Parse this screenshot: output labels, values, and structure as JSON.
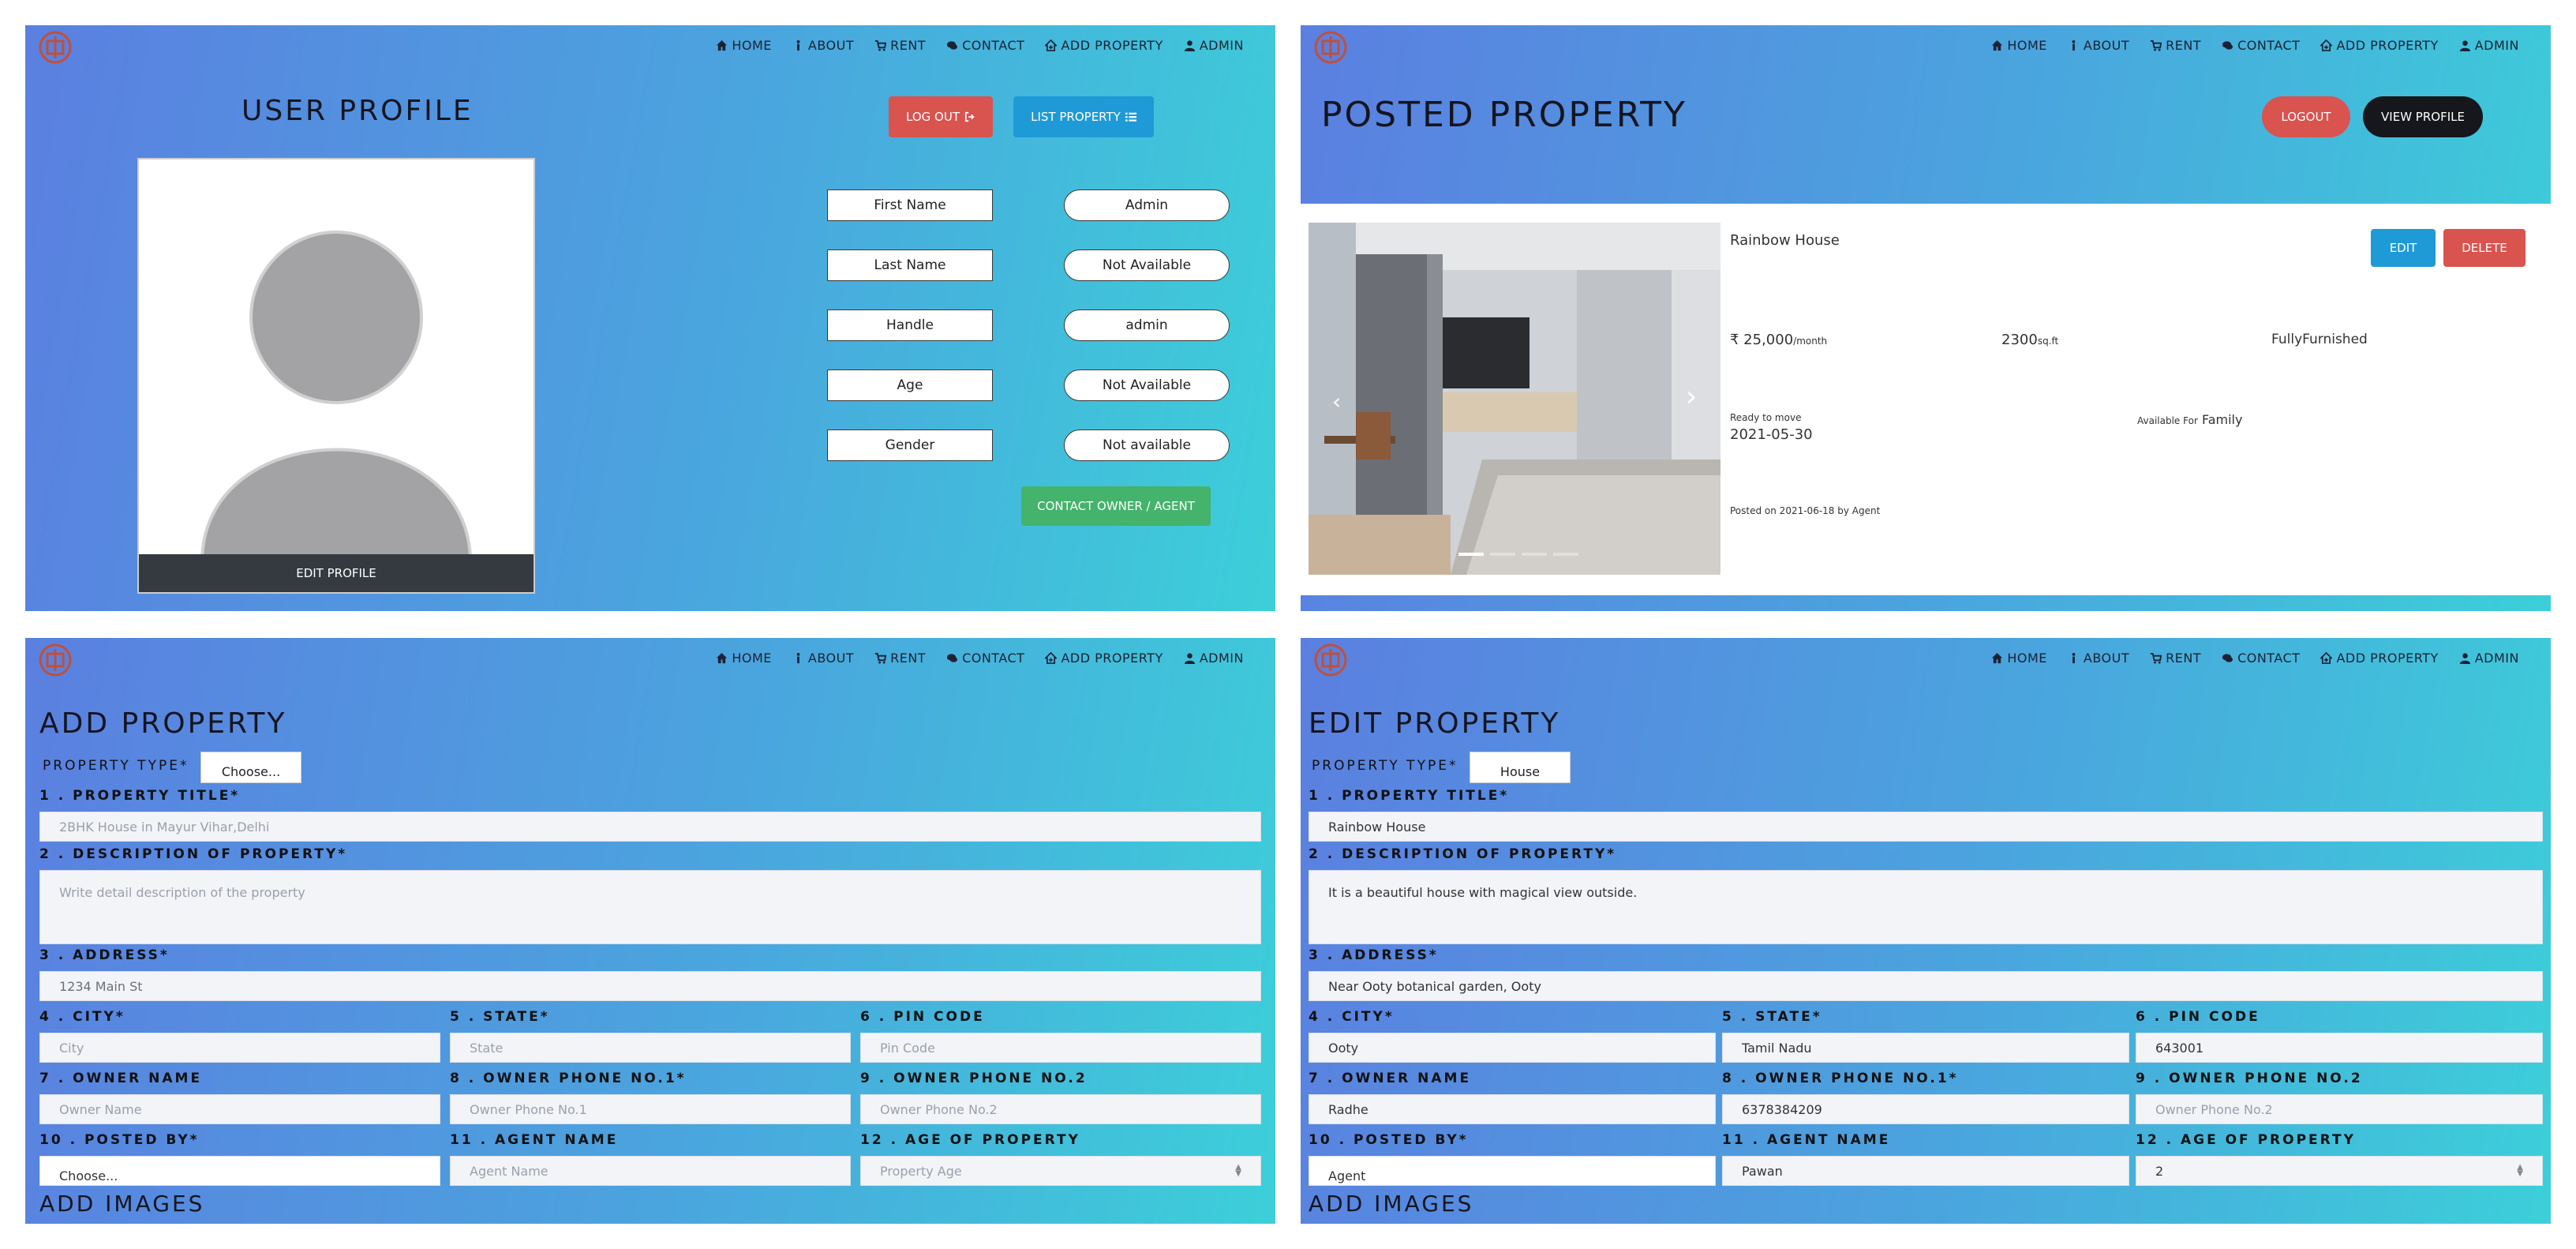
{
  "nav": {
    "home": "HOME",
    "about": "ABOUT",
    "rent": "RENT",
    "contact": "CONTACT",
    "add_property": "ADD PROPERTY",
    "admin": "ADMIN"
  },
  "user_profile": {
    "title": "USER PROFILE",
    "logout_label": "LOG OUT",
    "list_property_label": "LIST PROPERTY",
    "edit_profile_label": "EDIT PROFILE",
    "contact_label": "CONTACT OWNER / AGENT",
    "fields": [
      {
        "label": "First Name",
        "value": "Admin"
      },
      {
        "label": "Last Name",
        "value": "Not Available"
      },
      {
        "label": "Handle",
        "value": "admin"
      },
      {
        "label": "Age",
        "value": "Not Available"
      },
      {
        "label": "Gender",
        "value": "Not available"
      }
    ]
  },
  "posted_property": {
    "title": "POSTED PROPERTY",
    "logout_label": "LOGOUT",
    "view_profile_label": "VIEW PROFILE",
    "card": {
      "name": "Rainbow House",
      "edit_label": "EDIT",
      "delete_label": "DELETE",
      "price": "₹ 25,000",
      "price_unit": "/month",
      "area": "2300",
      "area_unit": "sq.ft",
      "furnishing": "FullyFurnished",
      "ready_label": "Ready to move",
      "ready_date": "2021-05-30",
      "available_label": "Available For",
      "available_value": "Family",
      "posted": "Posted on 2021-06-18 by Agent"
    }
  },
  "add_property": {
    "title": "ADD PROPERTY",
    "type_label": "PROPERTY TYPE*",
    "type_value": "Choose...",
    "l_title": "1 . PROPERTY TITLE*",
    "title_value": "2BHK House in Mayur Vihar,Delhi",
    "l_desc": "2 . DESCRIPTION OF PROPERTY*",
    "desc_value": "Write detail description of the property",
    "l_address": "3 . ADDRESS*",
    "address_value": "1234 Main St",
    "l_city": "4 . CITY*",
    "city_value": "City",
    "l_state": "5 . STATE*",
    "state_value": "State",
    "l_pin": "6 . PIN CODE",
    "pin_value": "Pin Code",
    "l_owner": "7 . OWNER NAME",
    "owner_value": "Owner Name",
    "l_phone1": "8 . OWNER PHONE NO.1*",
    "phone1_value": "Owner Phone No.1",
    "l_phone2": "9 . OWNER PHONE NO.2",
    "phone2_value": "Owner Phone No.2",
    "l_posted": "10 . POSTED BY*",
    "posted_value": "Choose...",
    "l_agent": "11 . AGENT NAME",
    "agent_value": "Agent Name",
    "l_age": "12 . AGE OF PROPERTY",
    "age_value": "Property Age",
    "images_title": "ADD IMAGES"
  },
  "edit_property": {
    "title": "EDIT PROPERTY",
    "type_label": "PROPERTY TYPE*",
    "type_value": "House",
    "l_title": "1 . PROPERTY TITLE*",
    "title_value": "Rainbow House",
    "l_desc": "2 . DESCRIPTION OF PROPERTY*",
    "desc_value": "It is a beautiful house with magical view outside.",
    "l_address": "3 . ADDRESS*",
    "address_value": "Near Ooty botanical garden, Ooty",
    "l_city": "4 . CITY*",
    "city_value": "Ooty",
    "l_state": "5 . STATE*",
    "state_value": "Tamil Nadu",
    "l_pin": "6 . PIN CODE",
    "pin_value": "643001",
    "l_owner": "7 . OWNER NAME",
    "owner_value": "Radhe",
    "l_phone1": "8 . OWNER PHONE NO.1*",
    "phone1_value": "6378384209",
    "l_phone2": "9 . OWNER PHONE NO.2",
    "phone2_value": "Owner Phone No.2",
    "l_posted": "10 . POSTED BY*",
    "posted_value": "Agent",
    "l_agent": "11 . AGENT NAME",
    "agent_value": "Pawan",
    "l_age": "12 . AGE OF PROPERTY",
    "age_value": "2",
    "images_title": "ADD IMAGES"
  }
}
